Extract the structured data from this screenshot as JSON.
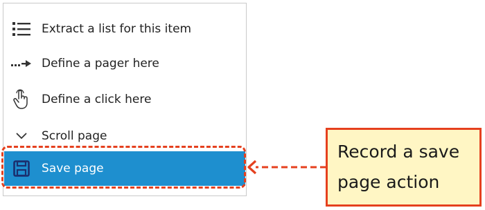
{
  "menu": {
    "items": [
      {
        "label": "Extract a list for this item",
        "icon": "list-icon"
      },
      {
        "label": "Define a pager here",
        "icon": "dotted-arrow-icon"
      },
      {
        "label": "Define a click here",
        "icon": "hand-pointer-icon"
      },
      {
        "label": "Scroll page",
        "icon": "chevron-down-icon"
      },
      {
        "label": "Save page",
        "icon": "save-icon",
        "selected": true
      }
    ]
  },
  "callout": {
    "line1": "Record a save",
    "line2": "page action"
  },
  "colors": {
    "selected_bg": "#1e8fcf",
    "annotation": "#e5401e",
    "callout_bg": "#fff6c4"
  }
}
